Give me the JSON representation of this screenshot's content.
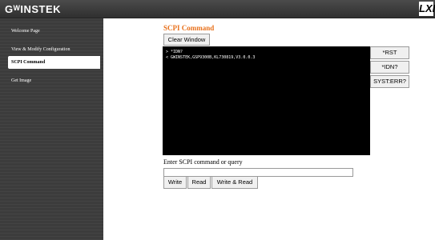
{
  "header": {
    "brand": "GᵂINSTEK",
    "lxi_label": "LXI"
  },
  "sidebar": {
    "items": [
      {
        "label": "Welcome Page",
        "active": false
      },
      {
        "label": "View & Modify Configuration",
        "active": false
      },
      {
        "label": "SCPI Command",
        "active": true
      },
      {
        "label": "Get Image",
        "active": false
      }
    ]
  },
  "main": {
    "title": "SCPI Command",
    "clear_window_label": "Clear Window",
    "console_lines": [
      "> *IDN?",
      "< GWINSTEK,GSP9300B,KL730819,V3.0.0.3"
    ],
    "quick_buttons": [
      "*RST",
      "*IDN?",
      "SYST:ERR?"
    ],
    "input_prompt": "Enter SCPI command or query",
    "input_value": "",
    "actions": {
      "write": "Write",
      "read": "Read",
      "write_read": "Write & Read"
    }
  },
  "colors": {
    "title_accent": "#e8711c",
    "sidebar_bg": "#3c3c3c",
    "console_bg": "#000000"
  }
}
